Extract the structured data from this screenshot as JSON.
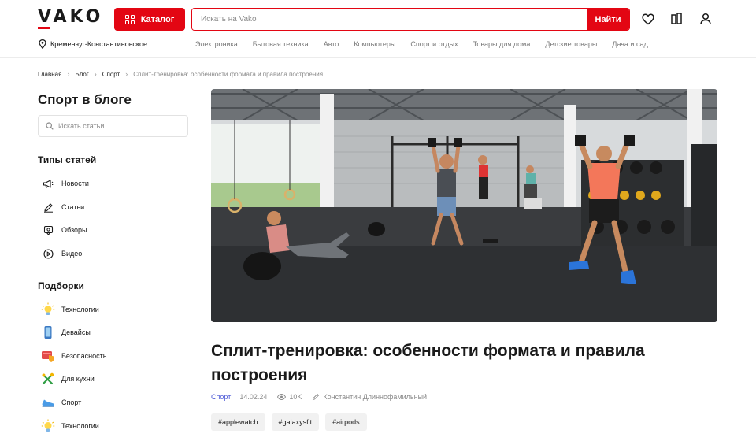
{
  "header": {
    "logo": "VAKO",
    "catalog_label": "Каталог",
    "search_placeholder": "Искать на Vako",
    "search_button": "Найти",
    "location": "Кременчуг-Константиновское",
    "nav": [
      "Электроника",
      "Бытовая техника",
      "Авто",
      "Компьютеры",
      "Спорт и отдых",
      "Товары для дома",
      "Детские товары",
      "Дача и сад"
    ]
  },
  "breadcrumb": {
    "items": [
      "Главная",
      "Блог",
      "Спорт"
    ],
    "current": "Сплит-тренировка: особенности формата и правила построения"
  },
  "sidebar": {
    "title": "Спорт в блоге",
    "search_placeholder": "Искать статьи",
    "types_title": "Типы статей",
    "types": [
      {
        "label": "Новости",
        "icon": "megaphone-icon"
      },
      {
        "label": "Статьи",
        "icon": "pencil-icon"
      },
      {
        "label": "Обзоры",
        "icon": "review-icon"
      },
      {
        "label": "Видео",
        "icon": "play-icon"
      }
    ],
    "collections_title": "Подборки",
    "collections": [
      {
        "label": "Технологии",
        "icon": "lightbulb-icon"
      },
      {
        "label": "Девайсы",
        "icon": "phone-icon"
      },
      {
        "label": "Безопасность",
        "icon": "security-icon"
      },
      {
        "label": "Для кухни",
        "icon": "kitchen-tools-icon"
      },
      {
        "label": "Спорт",
        "icon": "sneaker-icon"
      },
      {
        "label": "Технологии",
        "icon": "lightbulb-icon"
      }
    ]
  },
  "article": {
    "title": "Сплит-тренировка: особенности формата и правила построения",
    "category": "Спорт",
    "date": "14.02.24",
    "views": "10K",
    "author": "Константин Длиннофамильный",
    "tags": [
      "#applewatch",
      "#galaxysfit",
      "#airpods"
    ]
  },
  "colors": {
    "brand": "#e30613",
    "category_link": "#4a57d6",
    "tag_bg": "#f1f1f1"
  }
}
